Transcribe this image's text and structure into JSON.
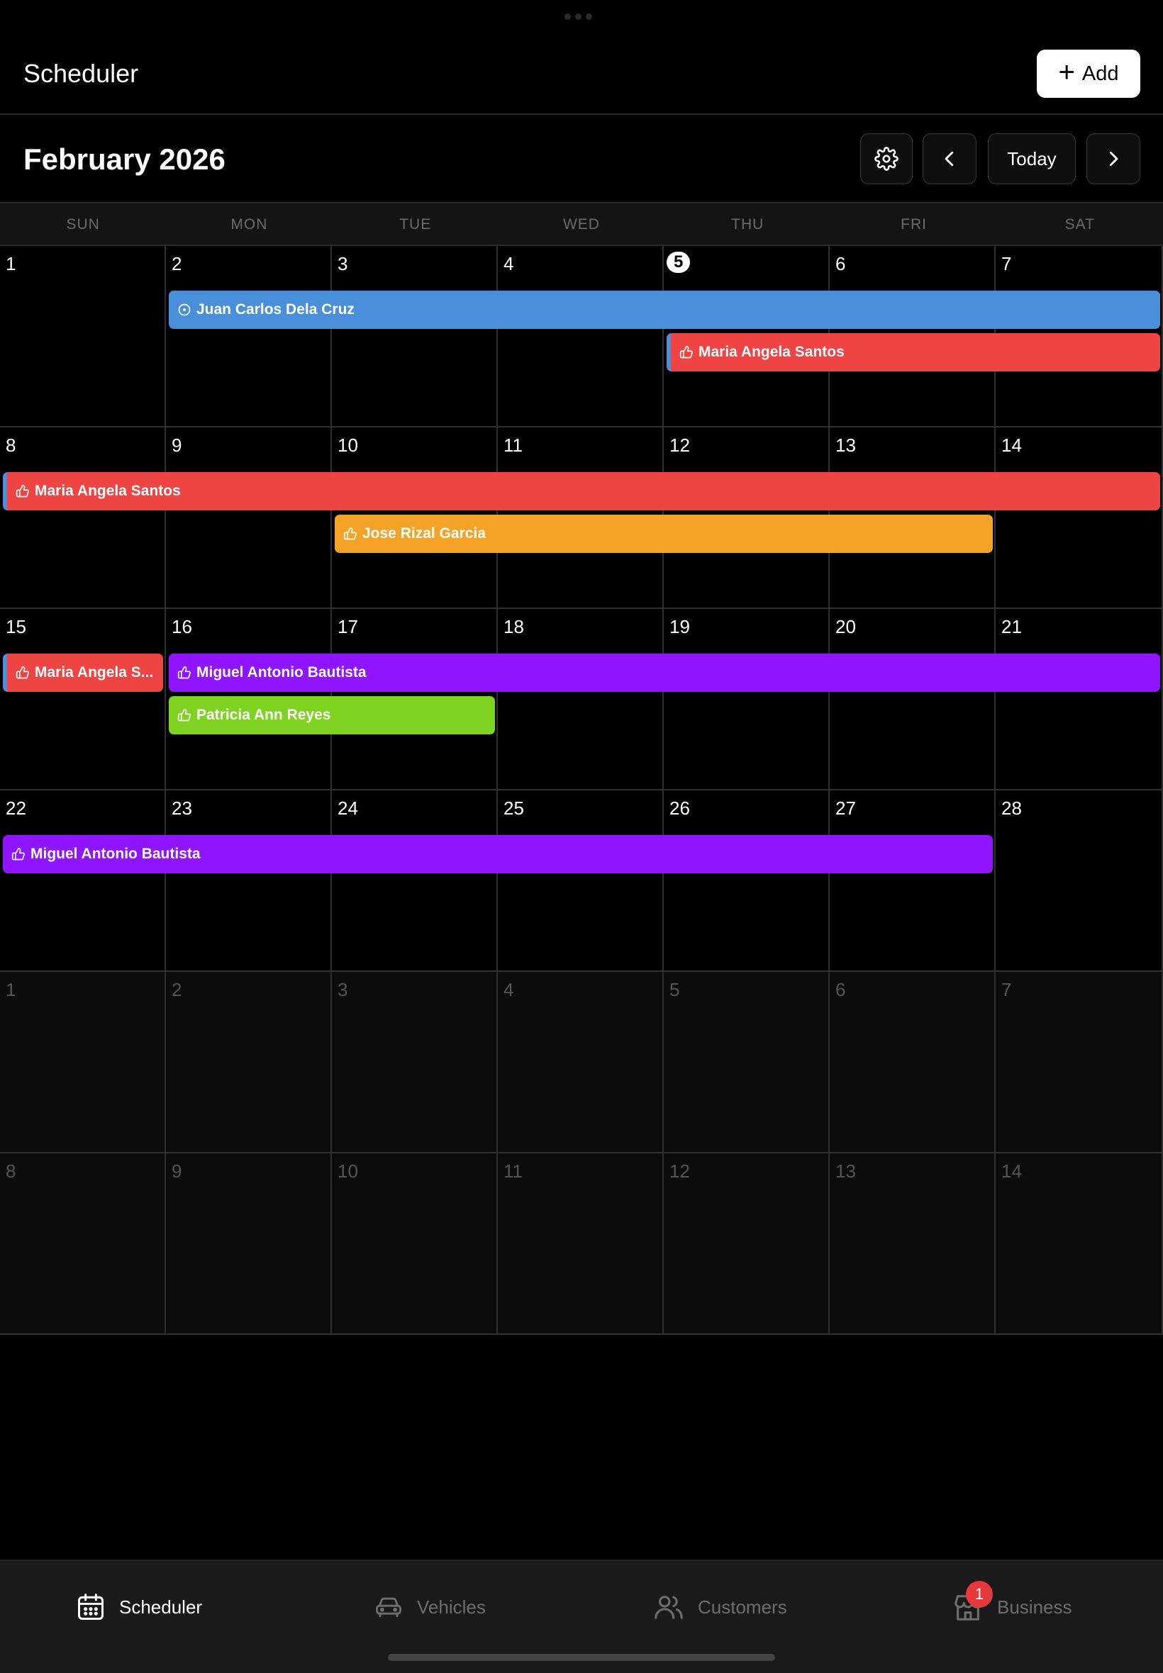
{
  "header": {
    "title": "Scheduler",
    "add_label": "Add"
  },
  "toolbar": {
    "month_title": "February 2026",
    "today_label": "Today"
  },
  "weekdays": [
    "SUN",
    "MON",
    "TUE",
    "WED",
    "THU",
    "FRI",
    "SAT"
  ],
  "weeks": [
    [
      "1",
      "2",
      "3",
      "4",
      "5",
      "6",
      "7"
    ],
    [
      "8",
      "9",
      "10",
      "11",
      "12",
      "13",
      "14"
    ],
    [
      "15",
      "16",
      "17",
      "18",
      "19",
      "20",
      "21"
    ],
    [
      "22",
      "23",
      "24",
      "25",
      "26",
      "27",
      "28"
    ],
    [
      "1",
      "2",
      "3",
      "4",
      "5",
      "6",
      "7"
    ],
    [
      "8",
      "9",
      "10",
      "11",
      "12",
      "13",
      "14"
    ]
  ],
  "today": "5",
  "events": [
    {
      "label": "Juan Carlos Dela Cruz",
      "color": "#4a8fd9",
      "icon": "clock-circle-icon"
    },
    {
      "label": "Maria Angela Santos",
      "color": "#ef4444",
      "icon": "thumbs-up-icon"
    },
    {
      "label": "Maria Angela Santos",
      "color": "#ef4444",
      "icon": "thumbs-up-icon"
    },
    {
      "label": "Jose Rizal Garcia",
      "color": "#f5a327",
      "icon": "thumbs-up-icon"
    },
    {
      "label": "Maria Angela S...",
      "color": "#ef4444",
      "icon": "thumbs-up-icon"
    },
    {
      "label": "Miguel Antonio Bautista",
      "color": "#8f14ff",
      "icon": "thumbs-up-icon"
    },
    {
      "label": "Patricia Ann Reyes",
      "color": "#7ed321",
      "icon": "thumbs-up-icon"
    },
    {
      "label": "Miguel Antonio Bautista",
      "color": "#8f14ff",
      "icon": "thumbs-up-icon"
    }
  ],
  "tabs": [
    {
      "label": "Scheduler",
      "icon": "calendar-icon",
      "active": true
    },
    {
      "label": "Vehicles",
      "icon": "car-icon",
      "active": false
    },
    {
      "label": "Customers",
      "icon": "users-icon",
      "active": false
    },
    {
      "label": "Business",
      "icon": "store-icon",
      "active": false,
      "badge": "1"
    }
  ]
}
